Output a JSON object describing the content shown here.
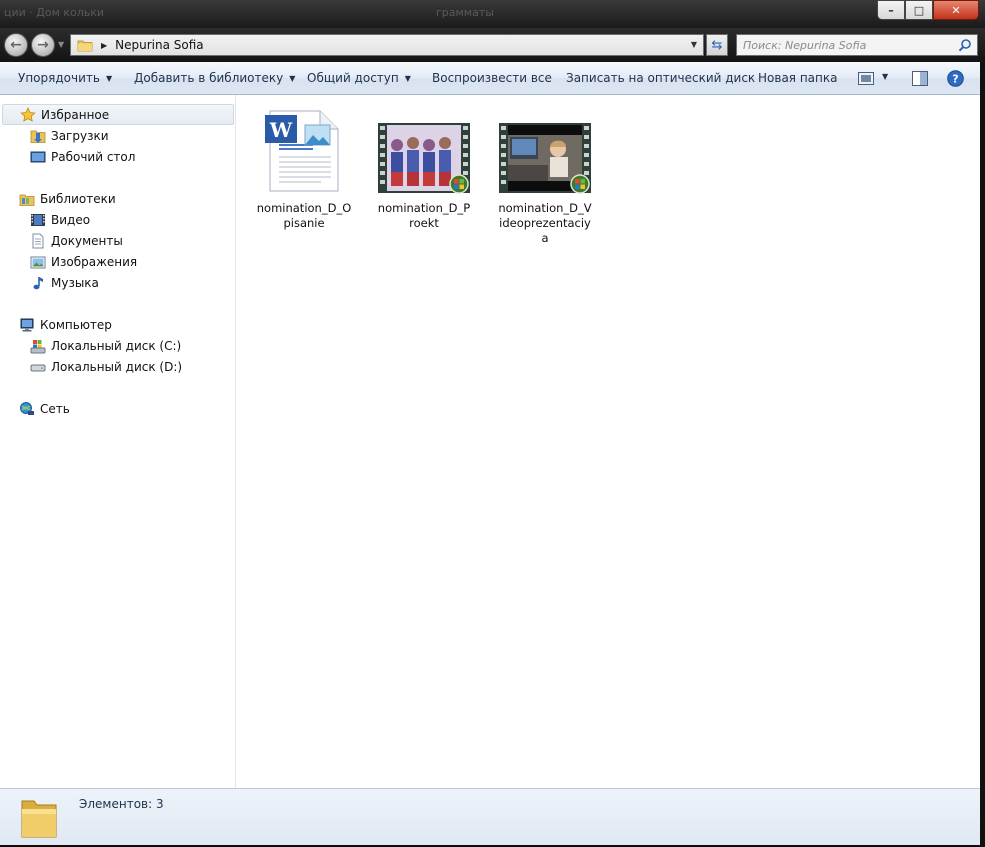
{
  "window": {
    "ghost_title_left": "ции  ·  Дом кольки",
    "ghost_title_mid": "грамматы",
    "minimize_glyph": "–",
    "maximize_glyph": "□",
    "close_glyph": "✕"
  },
  "address": {
    "path": "Nepurina Sofia",
    "back_glyph": "←",
    "forward_glyph": "→",
    "refresh_glyph": "⇆"
  },
  "search": {
    "placeholder": "Поиск: Nepurina Sofia"
  },
  "toolbar": {
    "organize_label": "Упорядочить",
    "add_library_label": "Добавить в библиотеку",
    "share_label": "Общий доступ",
    "play_all_label": "Воспроизвести все",
    "burn_label": "Записать на оптический диск",
    "new_folder_label": "Новая папка",
    "caret": "▼",
    "help_glyph": "?"
  },
  "sidebar": {
    "favorites": "Избранное",
    "downloads": "Загрузки",
    "desktop": "Рабочий стол",
    "libraries": "Библиотеки",
    "video": "Видео",
    "documents": "Документы",
    "images": "Изображения",
    "music": "Музыка",
    "computer": "Компьютер",
    "disk_c": "Локальный диск (C:)",
    "disk_d": "Локальный диск (D:)",
    "network": "Сеть"
  },
  "files": [
    {
      "name": "nomination_D_Opisanie",
      "type": "word-document"
    },
    {
      "name": "nomination_D_Proekt",
      "type": "video"
    },
    {
      "name": "nomination_D_Videoprezentaciya",
      "type": "video"
    }
  ],
  "status": {
    "count_text": "Элементов: 3"
  },
  "colors": {
    "toolbar_text": "#1e3250",
    "close_button": "#c4331b",
    "accent_blue": "#2a62b5"
  }
}
